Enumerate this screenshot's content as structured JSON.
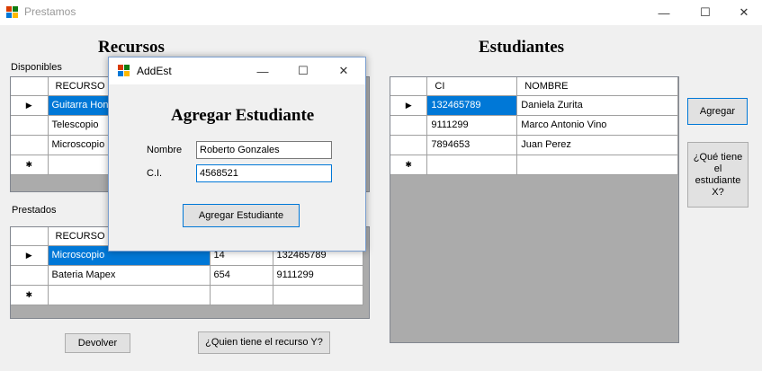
{
  "window": {
    "title": "Prestamos",
    "minimize": "—",
    "maximize": "☐",
    "close": "✕"
  },
  "recursos": {
    "heading": "Recursos",
    "disponibles_label": "Disponibles",
    "disponibles_grid": {
      "header": "RECURSO",
      "rows": [
        {
          "marker": "▶",
          "recurso": "Guitarra Honner"
        },
        {
          "marker": "",
          "recurso": "Telescopio"
        },
        {
          "marker": "",
          "recurso": "Microscopio"
        },
        {
          "marker": "✱",
          "recurso": ""
        }
      ]
    },
    "prestados_label": "Prestados",
    "prestados_grid": {
      "headers": [
        "RECURSO",
        "",
        ""
      ],
      "rows": [
        {
          "marker": "▶",
          "recurso": "Microscopio",
          "col2": "14",
          "col3": "132465789"
        },
        {
          "marker": "",
          "recurso": "Bateria Mapex",
          "col2": "654",
          "col3": "9111299"
        },
        {
          "marker": "✱",
          "recurso": "",
          "col2": "",
          "col3": ""
        }
      ]
    },
    "devolver_label": "Devolver",
    "quien_label": "¿Quien tiene el recurso Y?"
  },
  "estudiantes": {
    "heading": "Estudiantes",
    "grid": {
      "headers": [
        "CI",
        "NOMBRE"
      ],
      "rows": [
        {
          "marker": "▶",
          "ci": "132465789",
          "nombre": "Daniela Zurita"
        },
        {
          "marker": "",
          "ci": "9111299",
          "nombre": "Marco Antonio Vino"
        },
        {
          "marker": "",
          "ci": "7894653",
          "nombre": "Juan Perez"
        },
        {
          "marker": "✱",
          "ci": "",
          "nombre": ""
        }
      ]
    },
    "agregar_label": "Agregar",
    "que_tiene_label": "¿Qué tiene el estudiante X?"
  },
  "dialog": {
    "title": "AddEst",
    "heading": "Agregar Estudiante",
    "nombre_label": "Nombre",
    "nombre_value": "Roberto Gonzales",
    "ci_label": "C.I.",
    "ci_value": "4568521",
    "submit_label": "Agregar Estudiante",
    "minimize": "—",
    "maximize": "☐",
    "close": "✕"
  },
  "colors": {
    "selection": "#0078d7",
    "grid_bg": "#ababab",
    "focus_border": "#0078d7"
  }
}
